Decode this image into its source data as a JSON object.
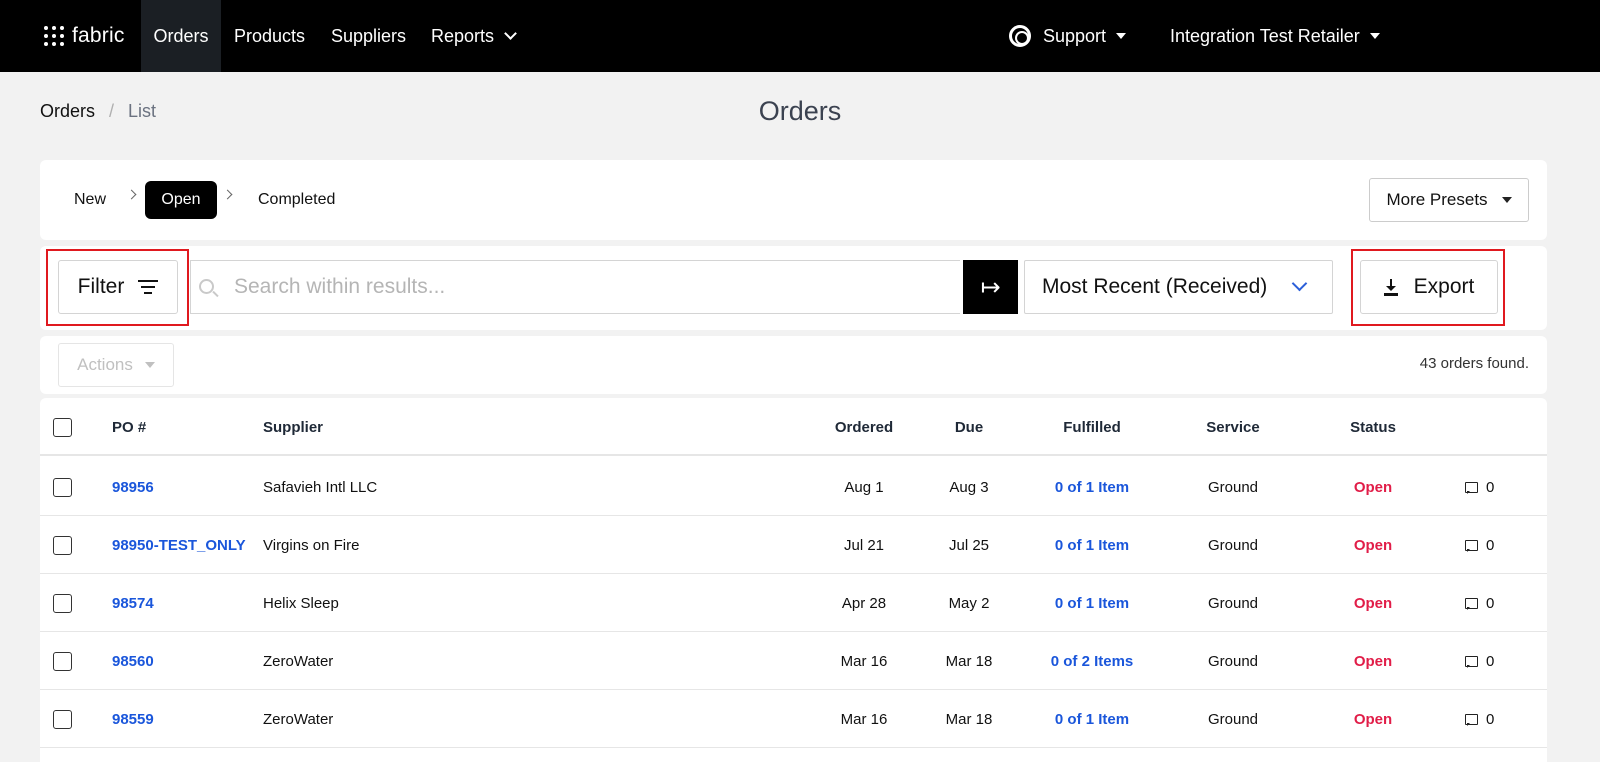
{
  "nav": {
    "logo_text": "fabric",
    "items": [
      {
        "label": "Orders"
      },
      {
        "label": "Products"
      },
      {
        "label": "Suppliers"
      },
      {
        "label": "Reports"
      }
    ],
    "support_label": "Support",
    "account_label": "Integration Test Retailer"
  },
  "breadcrumb": {
    "root": "Orders",
    "separator": "/",
    "current": "List"
  },
  "page_title": "Orders",
  "presets": {
    "items": [
      "New",
      "Open",
      "Completed"
    ],
    "active": "Open",
    "more_label": "More Presets"
  },
  "search": {
    "filter_label": "Filter",
    "placeholder": "Search within results...",
    "go_glyph": "↦",
    "sort_label": "Most Recent (Received)",
    "export_label": "Export"
  },
  "actions": {
    "label": "Actions",
    "orders_found": "43 orders found."
  },
  "table": {
    "columns": [
      "PO #",
      "Supplier",
      "Ordered",
      "Due",
      "Fulfilled",
      "Service",
      "Status"
    ],
    "rows": [
      {
        "po": "98956",
        "supplier": "Safavieh Intl LLC",
        "ordered": "Aug 1",
        "due": "Aug 3",
        "fulfilled": "0 of 1 Item",
        "service": "Ground",
        "status": "Open",
        "comments": "0"
      },
      {
        "po": "98950-TEST_ONLY",
        "supplier": "Virgins on Fire",
        "ordered": "Jul 21",
        "due": "Jul 25",
        "fulfilled": "0 of 1 Item",
        "service": "Ground",
        "status": "Open",
        "comments": "0"
      },
      {
        "po": "98574",
        "supplier": "Helix Sleep",
        "ordered": "Apr 28",
        "due": "May 2",
        "fulfilled": "0 of 1 Item",
        "service": "Ground",
        "status": "Open",
        "comments": "0"
      },
      {
        "po": "98560",
        "supplier": "ZeroWater",
        "ordered": "Mar 16",
        "due": "Mar 18",
        "fulfilled": "0 of 2 Items",
        "service": "Ground",
        "status": "Open",
        "comments": "0"
      },
      {
        "po": "98559",
        "supplier": "ZeroWater",
        "ordered": "Mar 16",
        "due": "Mar 18",
        "fulfilled": "0 of 1 Item",
        "service": "Ground",
        "status": "Open",
        "comments": "0"
      }
    ]
  },
  "colors": {
    "nav_bg": "#000000",
    "link_blue": "#1a56db",
    "status_open": "#e11d48",
    "highlight": "#e0191f"
  }
}
